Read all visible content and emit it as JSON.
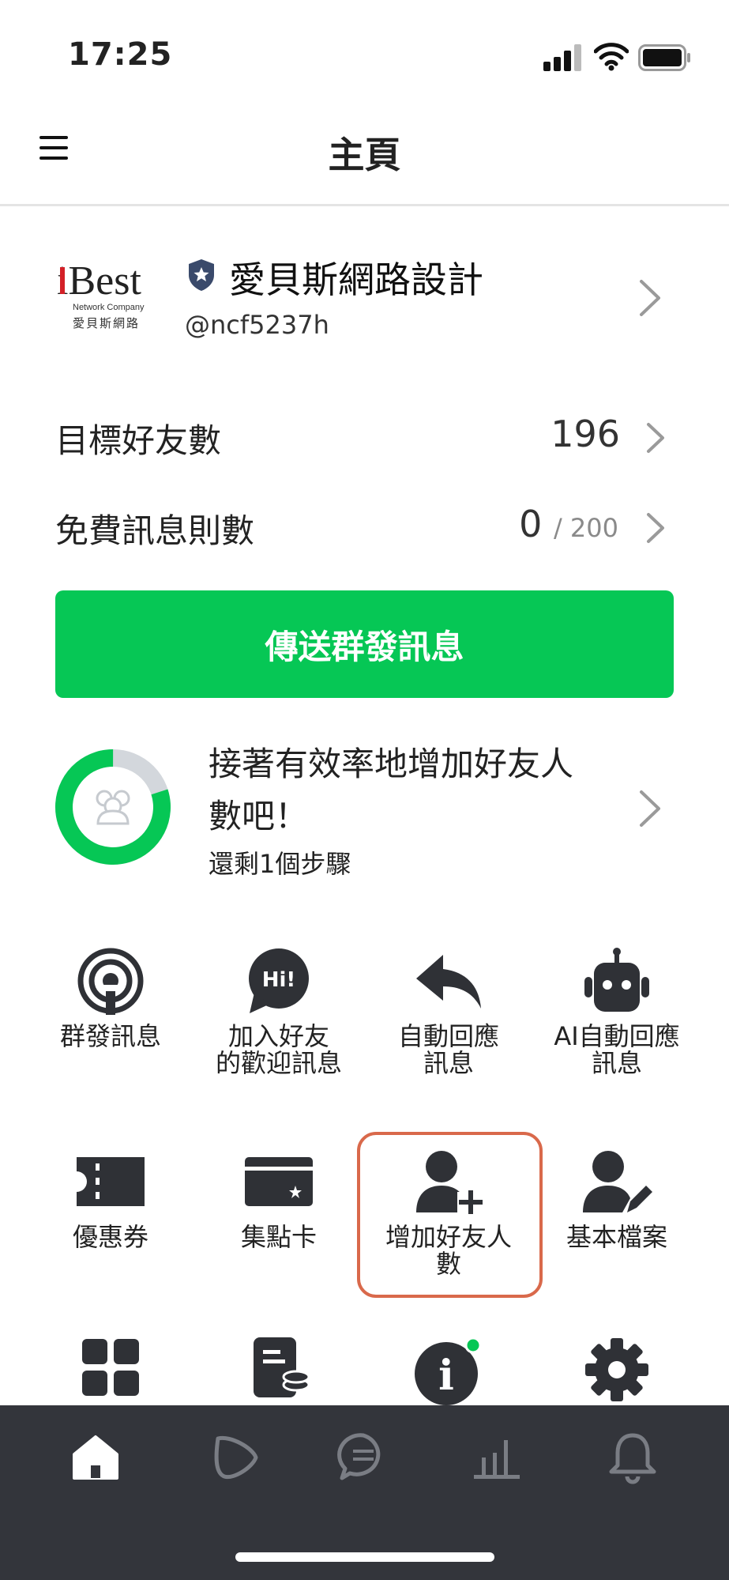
{
  "status_bar": {
    "time": "17:25"
  },
  "header": {
    "title": "主頁"
  },
  "account": {
    "logo_text": "iBest",
    "logo_subtext": "Network Company",
    "logo_cn": "愛貝斯網路",
    "name": "愛貝斯網路設計",
    "id": "@ncf5237h"
  },
  "stats": {
    "friends_label": "目標好友數",
    "friends_value": "196",
    "messages_label": "免費訊息則數",
    "messages_used": "0",
    "messages_limit": "/ 200"
  },
  "broadcast_button": {
    "label": "傳送群發訊息"
  },
  "progress": {
    "title": "接著有效率地增加好友人數吧！",
    "subtitle": "還剩1個步驟",
    "fraction_complete": 0.8
  },
  "tiles_row1": {
    "broadcast": "群發訊息",
    "welcome_1": "加入好友",
    "welcome_2": "的歡迎訊息",
    "autoreply_1": "自動回應",
    "autoreply_2": "訊息",
    "ai_1": "AI自動回應",
    "ai_2": "訊息"
  },
  "tiles_row2": {
    "coupon": "優惠券",
    "card": "集點卡",
    "addfriends_1": "增加好友人",
    "addfriends_2": "數",
    "profile": "基本檔案"
  },
  "icons": {
    "hi_bubble": "Hi!",
    "info": "i"
  },
  "colors": {
    "accent_green": "#06c755",
    "highlight_orange": "#d9694b",
    "tabbar_bg": "#33353b",
    "icon_dark": "#2f3136"
  }
}
